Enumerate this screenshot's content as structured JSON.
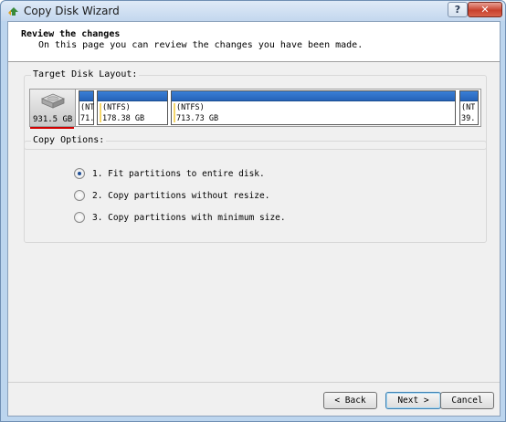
{
  "window": {
    "title": "Copy Disk Wizard",
    "help_label": "?",
    "close_label": "✕"
  },
  "header": {
    "title": "Review the changes",
    "subtitle": "On this page you can review the changes you have been made."
  },
  "layout": {
    "group_label": "Target Disk Layout:",
    "disk": {
      "size": "931.5 GB",
      "icon": "hard-disk-icon"
    },
    "partitions": [
      {
        "fs": "(NT",
        "size": "71."
      },
      {
        "fs": "(NTFS)",
        "size": "178.38 GB"
      },
      {
        "fs": "(NTFS)",
        "size": "713.73 GB"
      },
      {
        "fs": "(NT",
        "size": "39."
      }
    ]
  },
  "options": {
    "group_label": "Copy Options:",
    "items": [
      {
        "label": "1. Fit partitions to entire disk.",
        "checked": true
      },
      {
        "label": "2. Copy partitions without resize.",
        "checked": false
      },
      {
        "label": "3. Copy partitions with minimum size.",
        "checked": false
      }
    ]
  },
  "footer": {
    "back_label": "< Back",
    "next_label": "Next >",
    "cancel_label": "Cancel"
  },
  "colors": {
    "partition_bar": "#2f72cc",
    "disk_underline": "#d00000"
  }
}
